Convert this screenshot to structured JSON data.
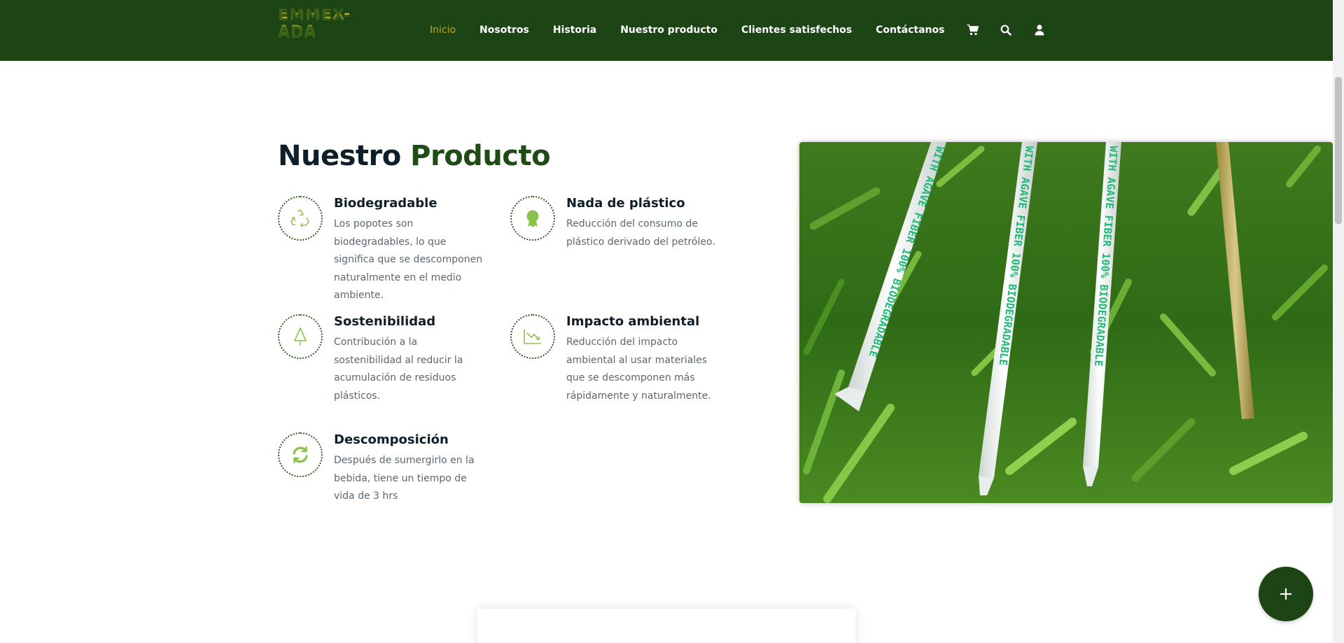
{
  "header": {
    "logo_text": "EMMEX-ADA",
    "nav": [
      {
        "label": "Inicio",
        "active": true
      },
      {
        "label": "Nosotros"
      },
      {
        "label": "Historia"
      },
      {
        "label": "Nuestro producto"
      },
      {
        "label": "Clientes satisfechos"
      },
      {
        "label": "Contáctanos"
      }
    ],
    "icons": [
      "cart-icon",
      "search-icon",
      "user-icon"
    ]
  },
  "section": {
    "title_part1": "Nuestro",
    "title_part2": "Producto"
  },
  "features": [
    {
      "title": "Biodegradable",
      "desc": "Los popotes son biodegradables, lo que significa que se descomponen naturalmente en el medio ambiente.",
      "icon": "recycle-icon"
    },
    {
      "title": "Nada de plástico",
      "desc": "Reducción del consumo de plástico derivado del petróleo.",
      "icon": "badge-icon"
    },
    {
      "title": "Sostenibilidad",
      "desc": "Contribución a la sostenibilidad al reducir la acumulación de residuos plásticos.",
      "icon": "tree-icon"
    },
    {
      "title": "Impacto ambiental",
      "desc": "Reducción del impacto ambiental al usar materiales que se descomponen más rápidamente y naturalmente.",
      "icon": "chart-down-icon"
    },
    {
      "title": "Descomposición",
      "desc": "Después de sumergirlo en la bebida, tiene un tiempo de vida de 3 hrs",
      "icon": "refresh-icon"
    }
  ],
  "photo": {
    "straw_text": "WITH AGAVE FIBER 100% BIODEGRADABLE"
  },
  "colors": {
    "brand_green": "#1d4414",
    "accent_gold": "#b7a620",
    "icon_green": "#8bc34a"
  }
}
